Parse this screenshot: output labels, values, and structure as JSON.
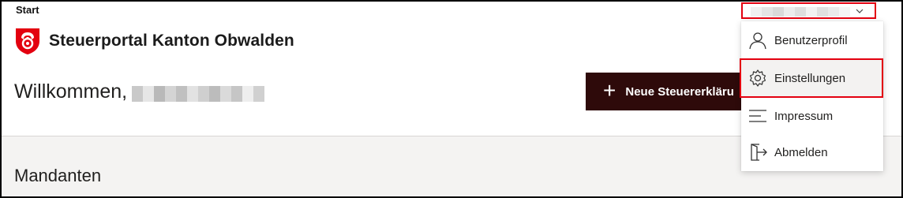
{
  "breadcrumb": "Start",
  "brand": {
    "title": "Steuerportal Kanton Obwalden",
    "logo_icon": "obwalden-coat-of-arms-icon",
    "logo_colors": {
      "red": "#e3000f",
      "white": "#ffffff"
    }
  },
  "welcome": {
    "label": "Willkommen,"
  },
  "actions": {
    "new_return_label": "Neue Steuererkläru",
    "new_return_icon": "plus-icon",
    "button_color": "#2e0a0a"
  },
  "section": {
    "title": "Mandanten"
  },
  "account": {
    "chevron_icon": "chevron-down-icon"
  },
  "menu": {
    "items": [
      {
        "label": "Benutzerprofil",
        "icon": "person-icon"
      },
      {
        "label": "Einstellungen",
        "icon": "gear-icon"
      },
      {
        "label": "Impressum",
        "icon": "lines-icon"
      },
      {
        "label": "Abmelden",
        "icon": "sign-out-icon"
      }
    ]
  },
  "highlight_color": "#e3000f"
}
